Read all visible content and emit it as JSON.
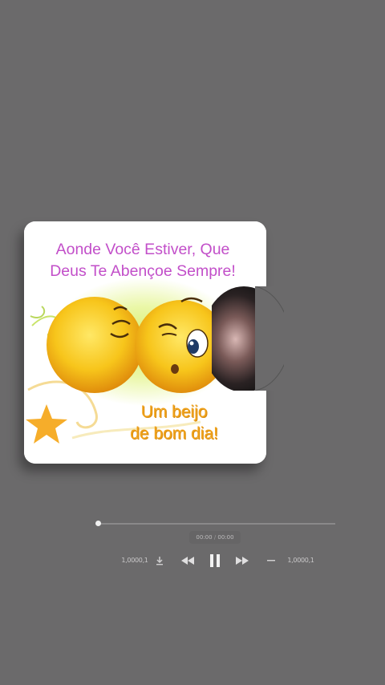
{
  "card": {
    "headline_line1": "Aonde Você Estiver,  Que",
    "headline_line2": "Deus Te Abençoe Sempre!",
    "greeting_line1": "Um beijo",
    "greeting_line2": "de bom dia!"
  },
  "player": {
    "progress": 0.0,
    "current_time": "00:00",
    "separator": "/",
    "total_time": "00:00",
    "left_label": "1,0000,1",
    "right_label": "1,0000,1",
    "icons": {
      "download": "download-icon",
      "previous": "rewind-icon",
      "play_pause": "pause-icon",
      "next": "fast-forward-icon",
      "more": "more-icon"
    }
  },
  "colors": {
    "background": "#6b6a6b",
    "headline": "#c24fc9",
    "greeting": "#f0a21a",
    "emoji": "#f7c51b",
    "star": "#f6ad2a"
  }
}
